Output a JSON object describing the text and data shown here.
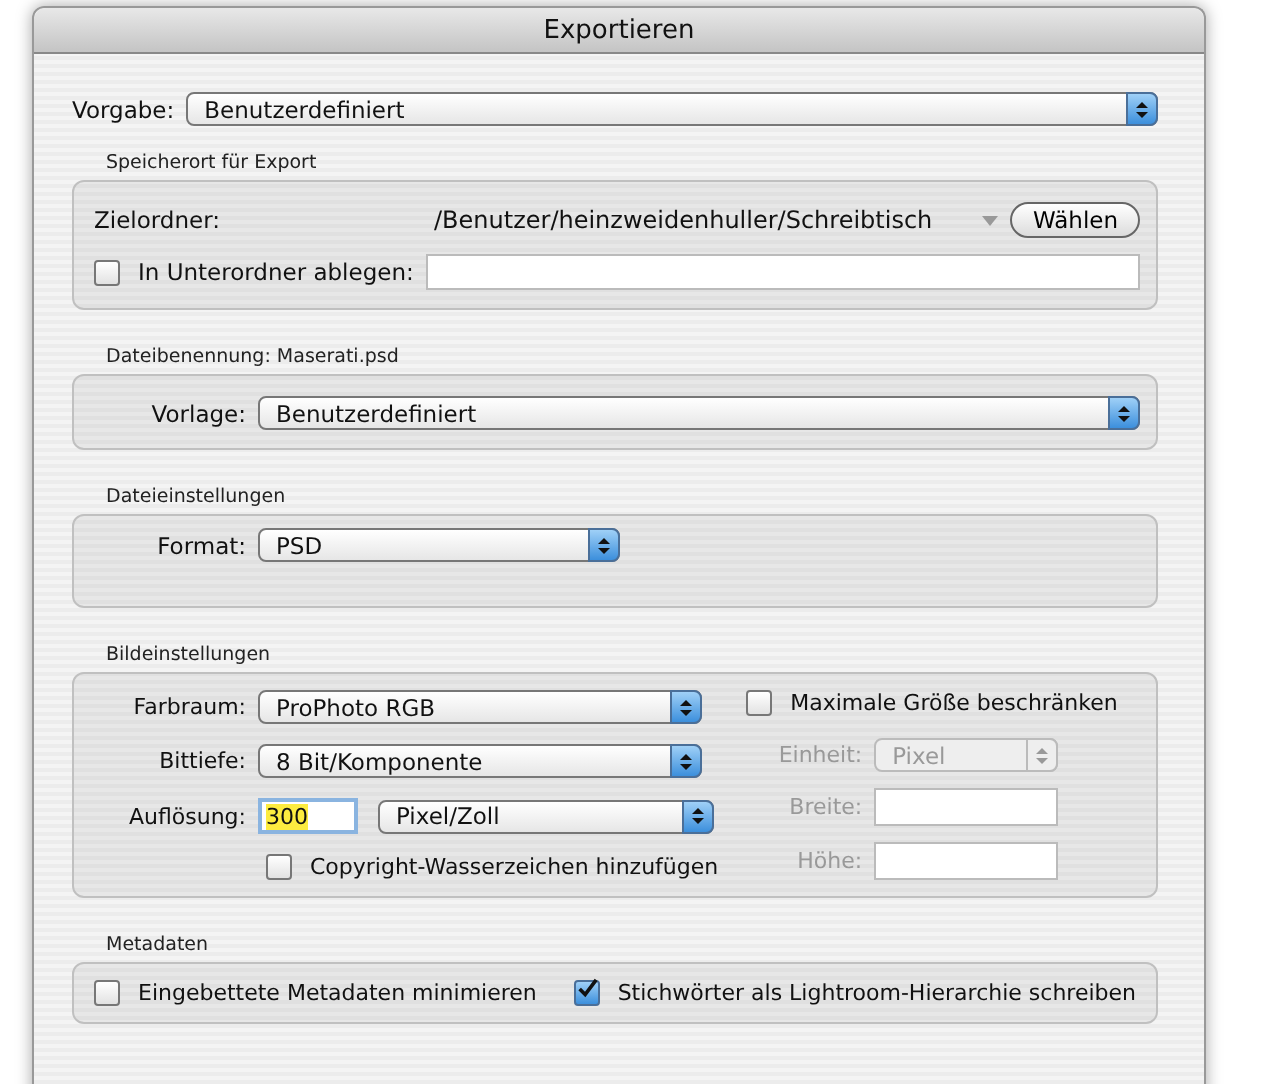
{
  "window": {
    "title": "Exportieren"
  },
  "preset": {
    "label": "Vorgabe:",
    "value": "Benutzerdefiniert"
  },
  "location": {
    "heading": "Speicherort für Export",
    "folder_label": "Zielordner:",
    "folder_path": "/Benutzer/heinzweidenhuller/Schreibtisch",
    "choose_button": "Wählen",
    "subfolder": {
      "label": "In Unterordner ablegen:",
      "checked": false
    }
  },
  "naming": {
    "heading": "Dateibenennung: Maserati.psd",
    "template_label": "Vorlage:",
    "template_value": "Benutzerdefiniert"
  },
  "file_settings": {
    "heading": "Dateieinstellungen",
    "format_label": "Format:",
    "format_value": "PSD"
  },
  "image_settings": {
    "heading": "Bildeinstellungen",
    "color_space": {
      "label": "Farbraum:",
      "value": "ProPhoto RGB"
    },
    "bit_depth": {
      "label": "Bittiefe:",
      "value": "8 Bit/Komponente"
    },
    "resolution": {
      "label": "Auflösung:",
      "value": "300",
      "text_selected": true,
      "unit": "Pixel/Zoll"
    },
    "watermark": {
      "label": "Copyright-Wasserzeichen hinzufügen",
      "checked": false
    },
    "limit_size": {
      "label": "Maximale Größe beschränken",
      "checked": false
    },
    "unit": {
      "label": "Einheit:",
      "value": "Pixel",
      "disabled": true
    },
    "width": {
      "label": "Breite:",
      "disabled": true
    },
    "height": {
      "label": "Höhe:",
      "disabled": true
    }
  },
  "metadata": {
    "heading": "Metadaten",
    "options": [
      {
        "label": "Eingebettete Metadaten minimieren",
        "checked": false
      },
      {
        "label": "Stichwörter als Lightroom-Hierarchie schreiben",
        "checked": true
      }
    ]
  }
}
